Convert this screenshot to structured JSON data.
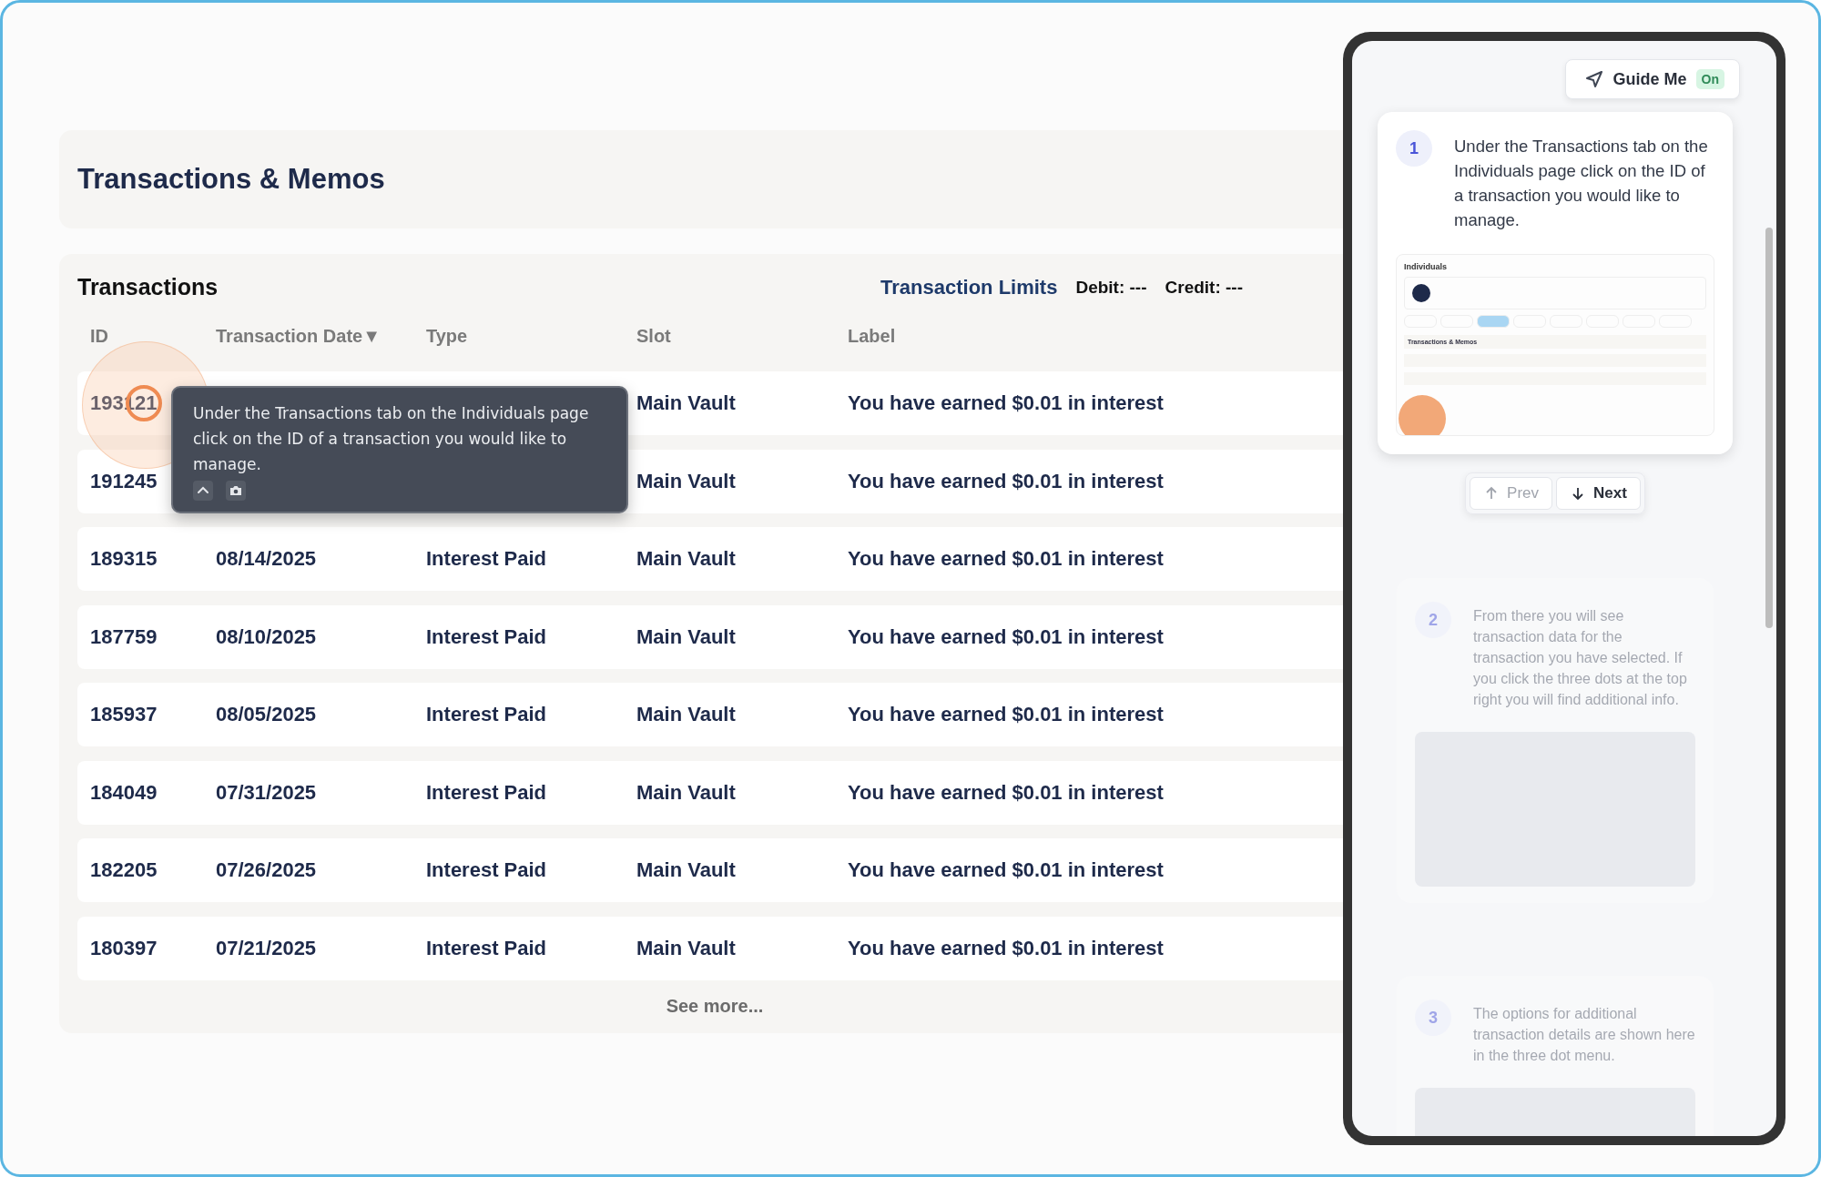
{
  "page": {
    "title": "Transactions & Memos"
  },
  "transactions": {
    "heading": "Transactions",
    "limits_label": "Transaction Limits",
    "debit": "Debit: ---",
    "credit": "Credit: ---",
    "columns": [
      {
        "label": "ID"
      },
      {
        "label": "Transaction Date",
        "sort_glyph": "▼"
      },
      {
        "label": "Type"
      },
      {
        "label": "Slot"
      },
      {
        "label": "Label"
      }
    ],
    "rows": [
      {
        "id": "193121",
        "slot": "Main Vault",
        "label": "You have earned $0.01 in interest"
      },
      {
        "id": "191245",
        "slot": "Main Vault",
        "label": "You have earned $0.01 in interest"
      },
      {
        "id": "189315",
        "date": "08/14/2025",
        "type": "Interest Paid",
        "slot": "Main Vault",
        "label": "You have earned $0.01 in interest"
      },
      {
        "id": "187759",
        "date": "08/10/2025",
        "type": "Interest Paid",
        "slot": "Main Vault",
        "label": "You have earned $0.01 in interest"
      },
      {
        "id": "185937",
        "date": "08/05/2025",
        "type": "Interest Paid",
        "slot": "Main Vault",
        "label": "You have earned $0.01 in interest"
      },
      {
        "id": "184049",
        "date": "07/31/2025",
        "type": "Interest Paid",
        "slot": "Main Vault",
        "label": "You have earned $0.01 in interest"
      },
      {
        "id": "182205",
        "date": "07/26/2025",
        "type": "Interest Paid",
        "slot": "Main Vault",
        "label": "You have earned $0.01 in interest"
      },
      {
        "id": "180397",
        "date": "07/21/2025",
        "type": "Interest Paid",
        "slot": "Main Vault",
        "label": "You have earned $0.01 in interest"
      }
    ],
    "see_more": "See more..."
  },
  "tooltip": {
    "text": "Under the Transactions tab on the Individuals page click on the ID of a transaction you would like to manage."
  },
  "guide": {
    "button": "Guide Me",
    "badge": "On",
    "prev": "Prev",
    "prev_disabled": true,
    "next": "Next",
    "steps": [
      {
        "number": "1",
        "active": true,
        "text": "Under the Transactions tab on the Individuals page click on the ID of a transaction you would like to manage.",
        "preview": {
          "title": "Individuals",
          "section": "Transactions & Memos"
        }
      },
      {
        "number": "2",
        "active": false,
        "text": "From there you will see transaction data for the transaction you have selected. If you click the three dots at the top right you will find additional info."
      },
      {
        "number": "3",
        "active": false,
        "text": "The options for additional transaction details are shown here in the three dot menu."
      }
    ]
  }
}
